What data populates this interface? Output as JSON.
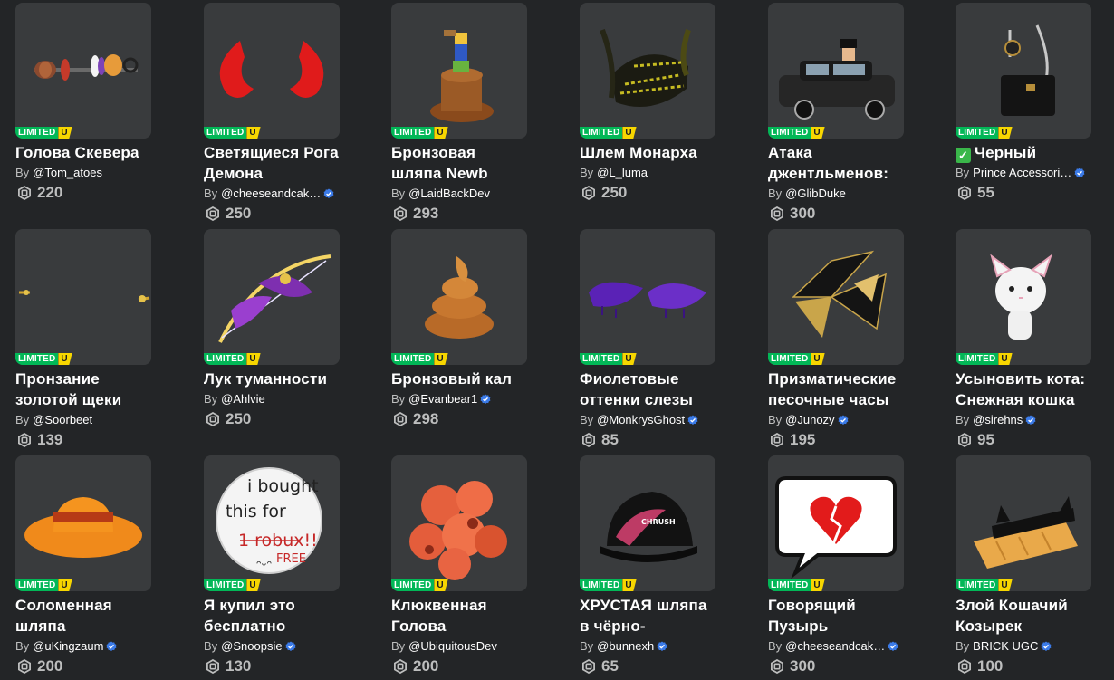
{
  "badge": {
    "limited": "LIMITED",
    "u": "U"
  },
  "by_label": "By",
  "items": [
    {
      "name": "Голова Скевера",
      "creator": "@Tom_atoes",
      "verified": false,
      "price": "220",
      "icon": "skewer-head-icon"
    },
    {
      "name": "Светящиеся Рога Демона",
      "creator": "@cheeseandcak…",
      "verified": true,
      "price": "250",
      "icon": "demon-horns-icon"
    },
    {
      "name": "Бронзовая шляпа Newb",
      "creator": "@LaidBackDev",
      "verified": false,
      "price": "293",
      "icon": "bronze-hat-icon"
    },
    {
      "name": "Шлем Монарха",
      "creator": "@L_luma",
      "verified": false,
      "price": "250",
      "icon": "monarch-helmet-icon"
    },
    {
      "name": "Атака джентльменов:",
      "creator": "@GlibDuke",
      "verified": false,
      "price": "300",
      "icon": "limo-icon"
    },
    {
      "name": "Черный",
      "checkmark": true,
      "creator": "Prince Accessori…",
      "verified": true,
      "price": "55",
      "icon": "black-bag-icon"
    },
    {
      "name": "Пронзание золотой щеки",
      "creator": "@Soorbeet",
      "verified": false,
      "price": "139",
      "icon": "cheek-piercing-icon"
    },
    {
      "name": "Лук туманности",
      "creator": "@Ahlvie",
      "verified": false,
      "price": "250",
      "icon": "nebula-bow-icon"
    },
    {
      "name": "Бронзовый кал",
      "creator": "@Evanbear1",
      "verified": true,
      "price": "298",
      "icon": "bronze-poop-icon"
    },
    {
      "name": "Фиолетовые оттенки слезы",
      "creator": "@MonkrysGhost",
      "verified": true,
      "price": "85",
      "icon": "purple-tears-icon"
    },
    {
      "name": "Призматические песочные часы",
      "creator": "@Junozy",
      "verified": true,
      "price": "195",
      "icon": "hourglass-icon"
    },
    {
      "name": "Усыновить кота: Снежная кошка",
      "creator": "@sirehns",
      "verified": true,
      "price": "95",
      "icon": "snow-cat-icon"
    },
    {
      "name": "Соломенная шляпа",
      "creator": "@uKingzaum",
      "verified": true,
      "price": "200",
      "icon": "straw-hat-icon"
    },
    {
      "name": "Я купил это бесплатно",
      "creator": "@Snoopsie",
      "verified": true,
      "price": "130",
      "icon": "bought-free-sign-icon",
      "art_text": [
        "i bought",
        "this for",
        "1 robux!!",
        "FREE"
      ]
    },
    {
      "name": "Клюквенная Голова",
      "creator": "@UbiquitousDev",
      "verified": false,
      "price": "200",
      "icon": "cranberry-head-icon"
    },
    {
      "name": "ХРУСТАЯ шляпа в чёрно-",
      "creator": "@bunnexh",
      "verified": true,
      "price": "65",
      "icon": "crunchy-hat-icon",
      "art_text": [
        "CHRUSH"
      ]
    },
    {
      "name": "Говорящий Пузырь",
      "creator": "@cheeseandcak…",
      "verified": true,
      "price": "300",
      "icon": "speech-bubble-heart-icon"
    },
    {
      "name": "Злой Кошачий Козырек",
      "creator": "BRICK UGC",
      "verified": true,
      "price": "100",
      "icon": "cat-visor-icon"
    }
  ]
}
